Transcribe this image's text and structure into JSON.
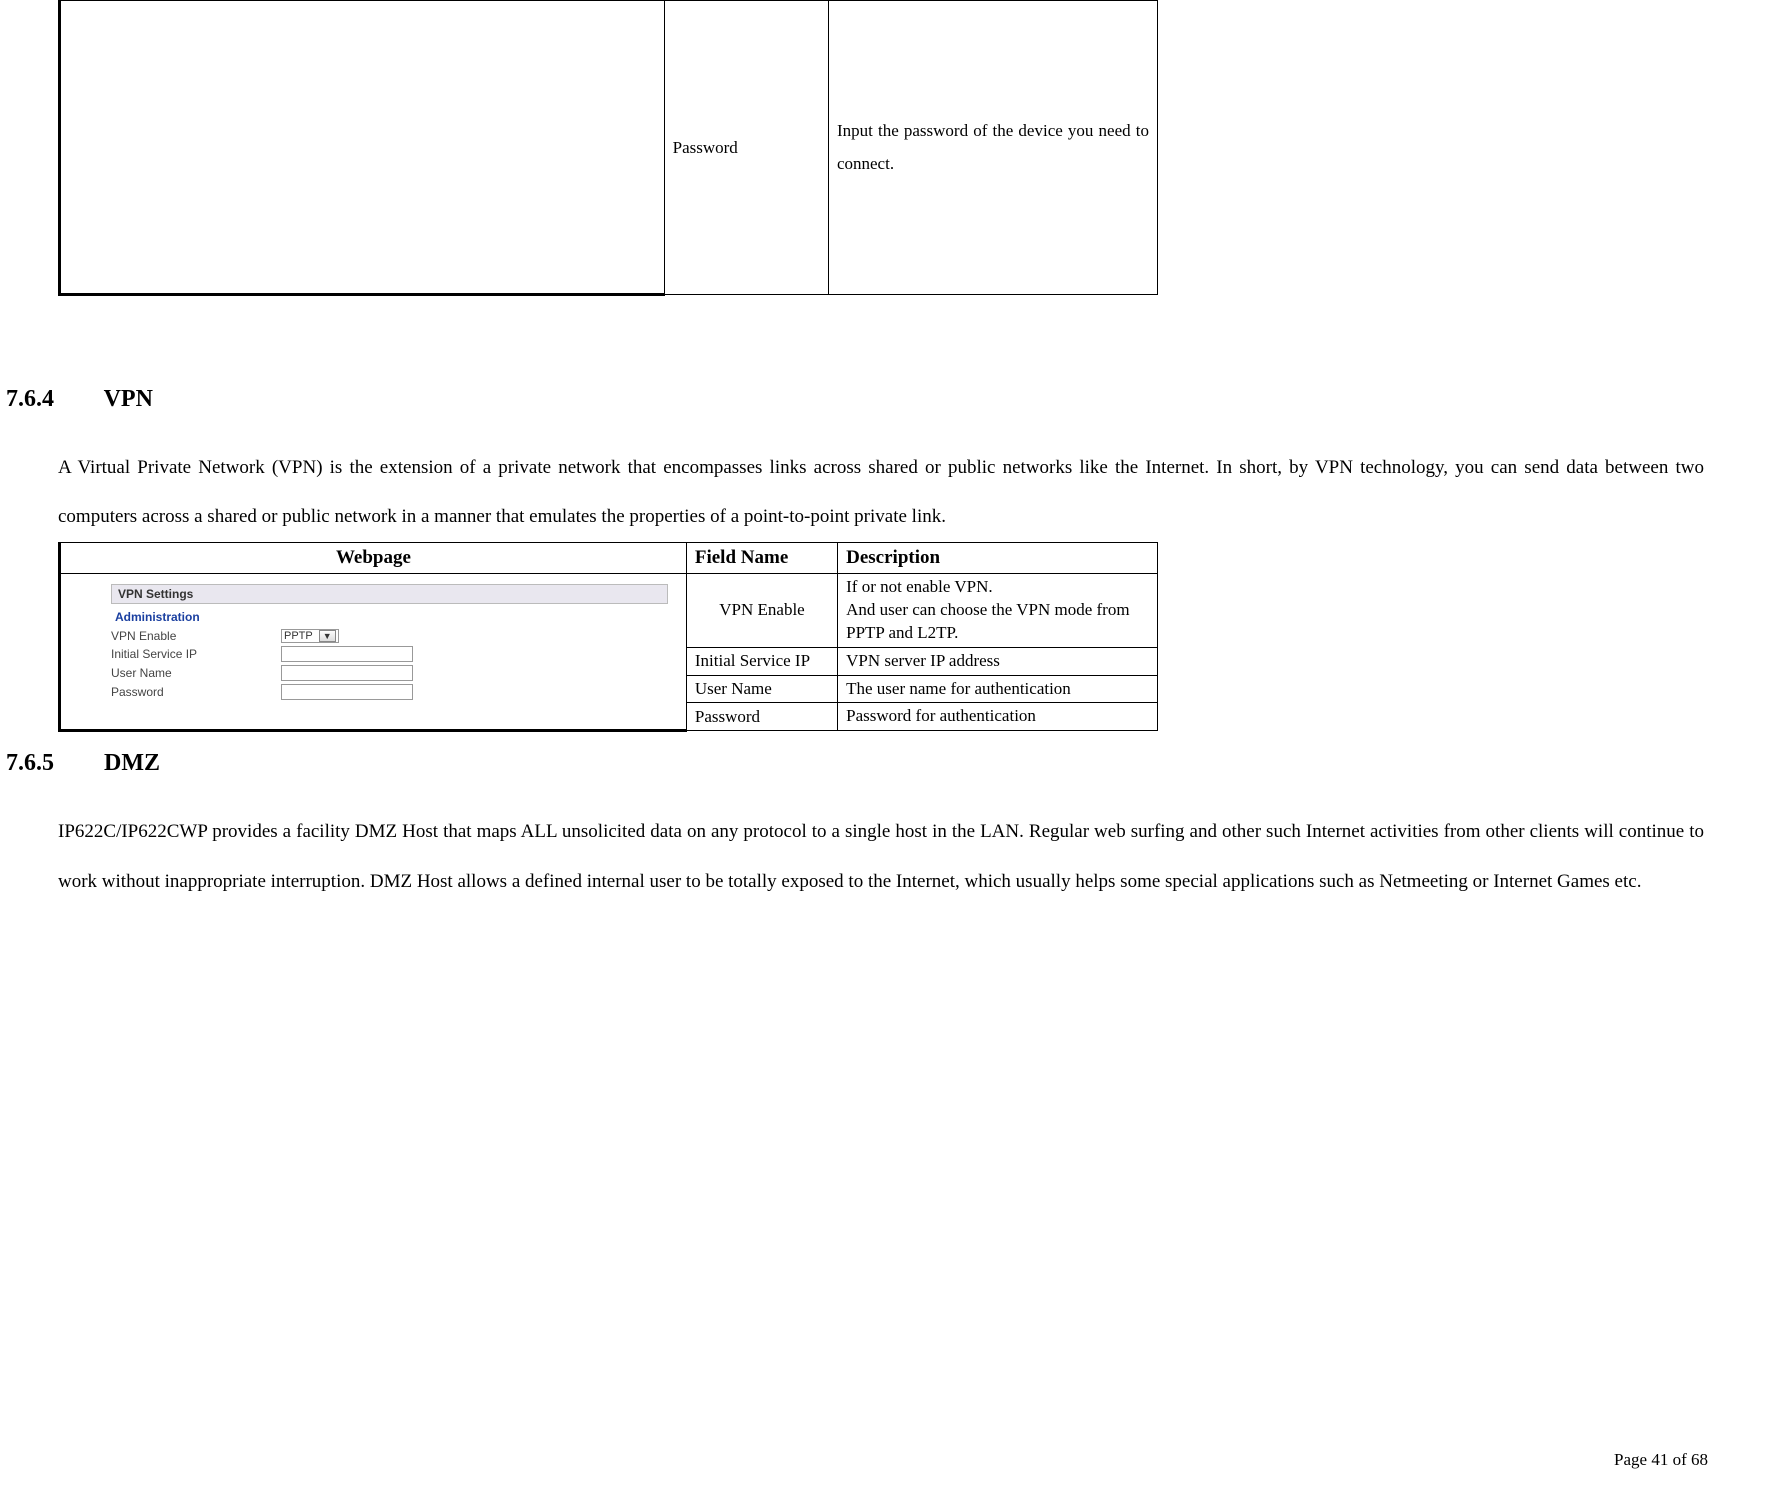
{
  "top_table": {
    "field": "Password",
    "description": "Input the password of the device you need to connect."
  },
  "section_vpn": {
    "number": "7.6.4",
    "title": "VPN",
    "paragraph": "A Virtual Private Network (VPN) is the extension of a private network that encompasses links across shared or public networks like the Internet. In short, by VPN technology, you can send data between two computers across a shared or public network in a manner that emulates the properties of a point-to-point private link."
  },
  "vpn_table": {
    "headers": {
      "webpage": "Webpage",
      "field": "Field Name",
      "description": "Description"
    },
    "rows": [
      {
        "field": "VPN Enable",
        "description": "If or not enable VPN.\nAnd user can choose the VPN mode from PPTP and L2TP."
      },
      {
        "field": "Initial Service IP",
        "description": "VPN server IP address"
      },
      {
        "field": "User Name",
        "description": "The user name for authentication"
      },
      {
        "field": "Password",
        "description": "Password for authentication"
      }
    ],
    "admin": {
      "panel_title": "VPN Settings",
      "section_title": "Administration",
      "rows": {
        "vpn_enable_label": "VPN Enable",
        "vpn_enable_value": "PPTP",
        "initial_ip_label": "Initial Service IP",
        "user_name_label": "User Name",
        "password_label": "Password"
      }
    }
  },
  "section_dmz": {
    "number": "7.6.5",
    "title": "DMZ",
    "paragraph": "IP622C/IP622CWP provides a facility DMZ Host that maps ALL unsolicited data on any protocol to a single host in the LAN. Regular web surfing and other such Internet activities from other clients will continue to work without inappropriate interruption. DMZ Host allows a defined internal user to be totally exposed to the Internet, which usually helps some special applications such as Netmeeting or Internet Games etc."
  },
  "footer": "Page 41 of 68"
}
